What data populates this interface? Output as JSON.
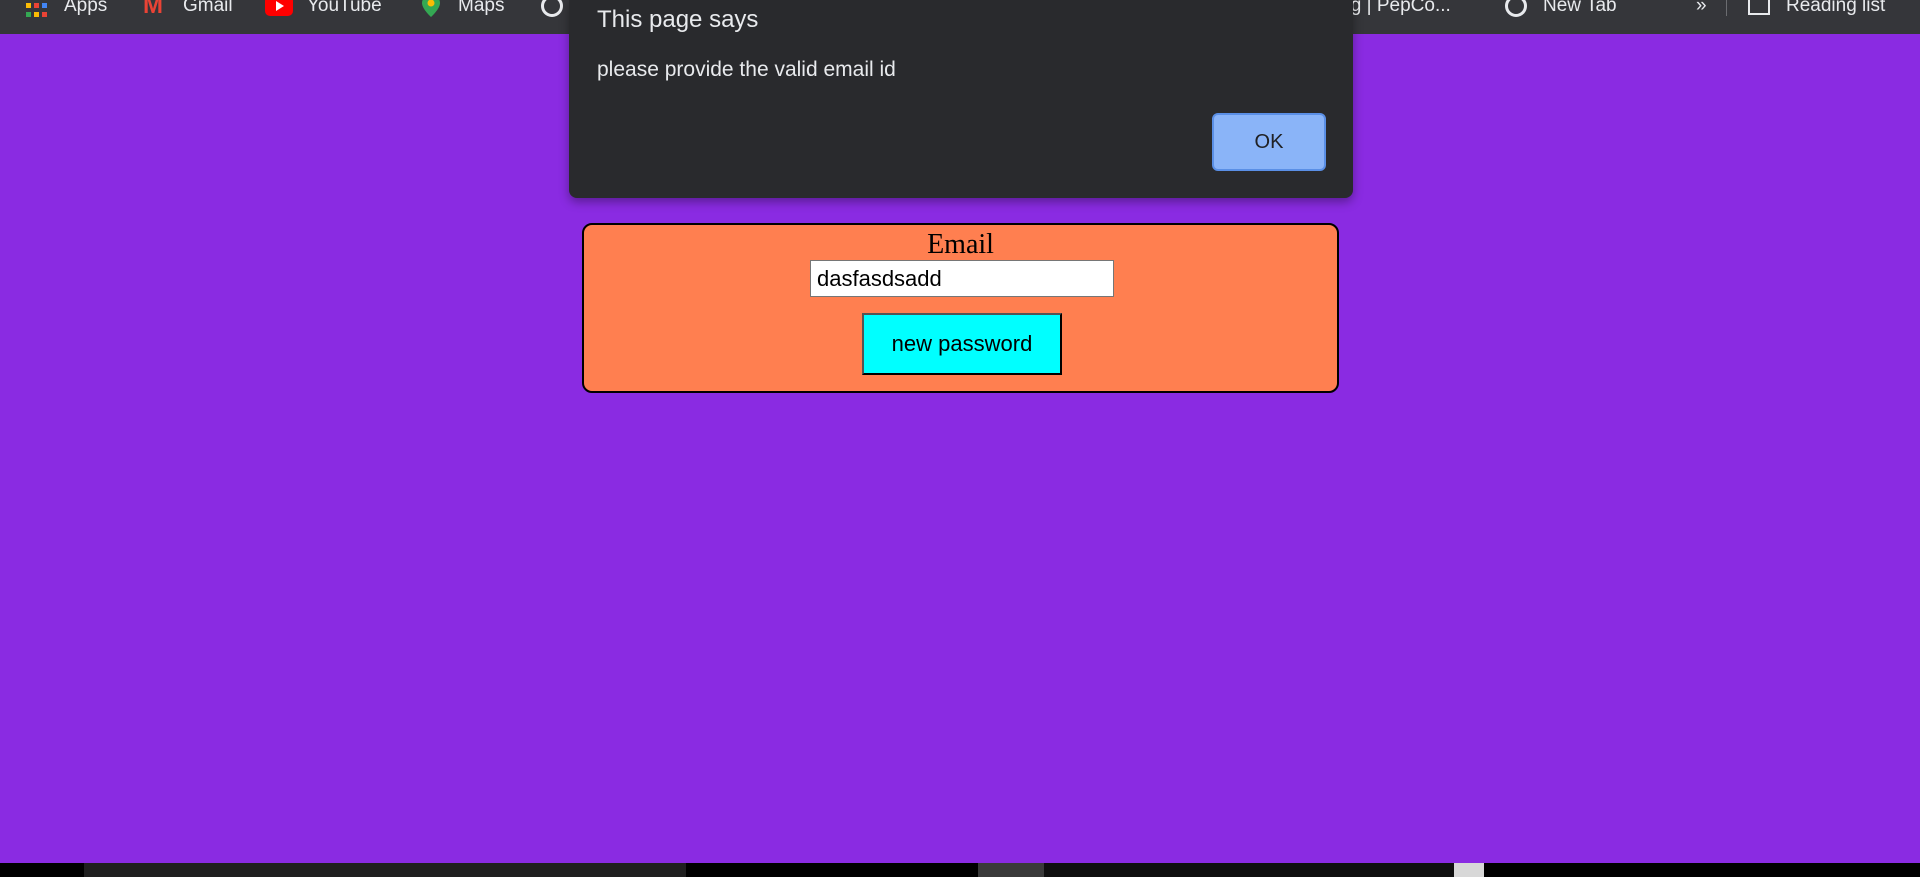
{
  "bookmarks": {
    "items": [
      {
        "label": "Apps",
        "icon": "apps-grid-icon"
      },
      {
        "label": "Gmail",
        "icon": "gmail-icon"
      },
      {
        "label": "YouTube",
        "icon": "youtube-icon"
      },
      {
        "label": "Maps",
        "icon": "maps-icon"
      },
      {
        "label": "ing | PepCo...",
        "icon": "globe-icon"
      },
      {
        "label": "New Tab",
        "icon": "globe-icon"
      }
    ],
    "overflow_label": "»",
    "reading_list_label": "Reading list"
  },
  "dialog": {
    "title": "This page says",
    "message": "please provide the valid email id",
    "ok_label": "OK"
  },
  "form": {
    "email_label": "Email",
    "email_value": "dasfasdsadd",
    "submit_label": "new password"
  },
  "colors": {
    "page_background": "#8a2be2",
    "card_background": "#ff7f50",
    "button_background": "#00ffff",
    "dialog_background": "#292a2d",
    "ok_button": "#8ab4f8"
  }
}
